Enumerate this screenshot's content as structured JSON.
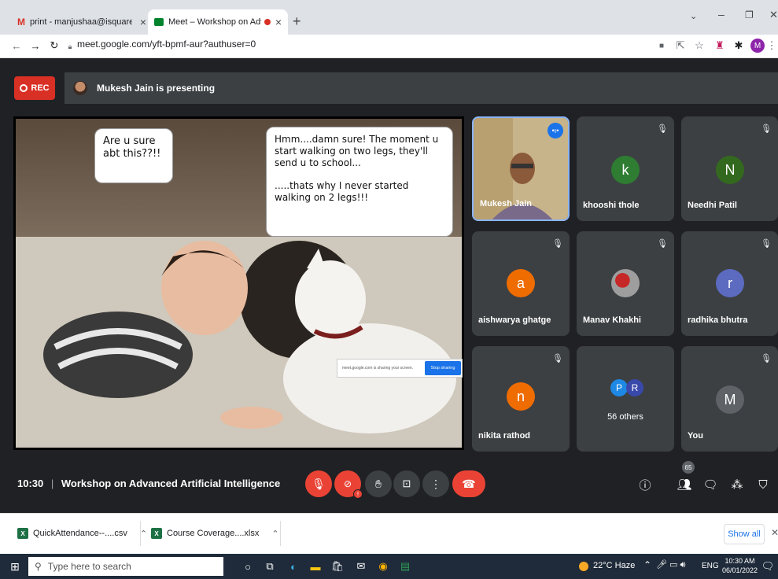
{
  "browser": {
    "tabs": [
      {
        "title": "print - manjushaa@isquareit.edu",
        "active": false
      },
      {
        "title": "Meet – Workshop on Advanc",
        "active": true
      }
    ],
    "url": "meet.google.com/yft-bpmf-aur?authuser=0",
    "profile_initial": "M"
  },
  "meet": {
    "rec_label": "REC",
    "presenting_text": "Mukesh Jain is presenting",
    "shared_screen": {
      "bubble_left": "Are u sure\nabt this??!!",
      "bubble_right_1": "Hmm....damn sure! The moment u\nstart walking on two legs, they'll\nsend u to school...",
      "bubble_right_2": ".....thats why I never started\nwalking on 2 legs!!!",
      "share_notice": "meet.google.com is sharing your screen.",
      "stop_sharing": "Stop sharing"
    },
    "participants": [
      {
        "name": "Mukesh Jain",
        "type": "video"
      },
      {
        "name": "khooshi thole",
        "initial": "k",
        "color": "#2e7d32"
      },
      {
        "name": "Needhi Patil",
        "initial": "N",
        "color": "#33691e"
      },
      {
        "name": "aishwarya ghatge",
        "initial": "a",
        "color": "#ef6c00"
      },
      {
        "name": "Manav Khakhi",
        "initial": "",
        "color": "#777777"
      },
      {
        "name": "radhika bhutra",
        "initial": "r",
        "color": "#5c6bc0"
      },
      {
        "name": "nikita rathod",
        "initial": "n",
        "color": "#ef6c00"
      },
      {
        "name": "56 others",
        "initial_p": "P",
        "initial_r": "R"
      },
      {
        "name": "You",
        "initial": "M",
        "color": "#5f6368"
      }
    ],
    "time": "10:30",
    "separator": "|",
    "meeting_title": "Workshop on Advanced Artificial Intelligence",
    "people_count": "65"
  },
  "downloads": {
    "items": [
      "QuickAttendance--....csv",
      "Course Coverage....xlsx"
    ],
    "show_all": "Show all"
  },
  "taskbar": {
    "search_placeholder": "Type here to search",
    "weather": "22°C Haze",
    "lang": "ENG",
    "clock_time": "10:30 AM",
    "clock_date": "06/01/2022"
  },
  "colors": {
    "rec": "#d93025",
    "hangup": "#ea4335",
    "accent": "#1a73e8"
  }
}
